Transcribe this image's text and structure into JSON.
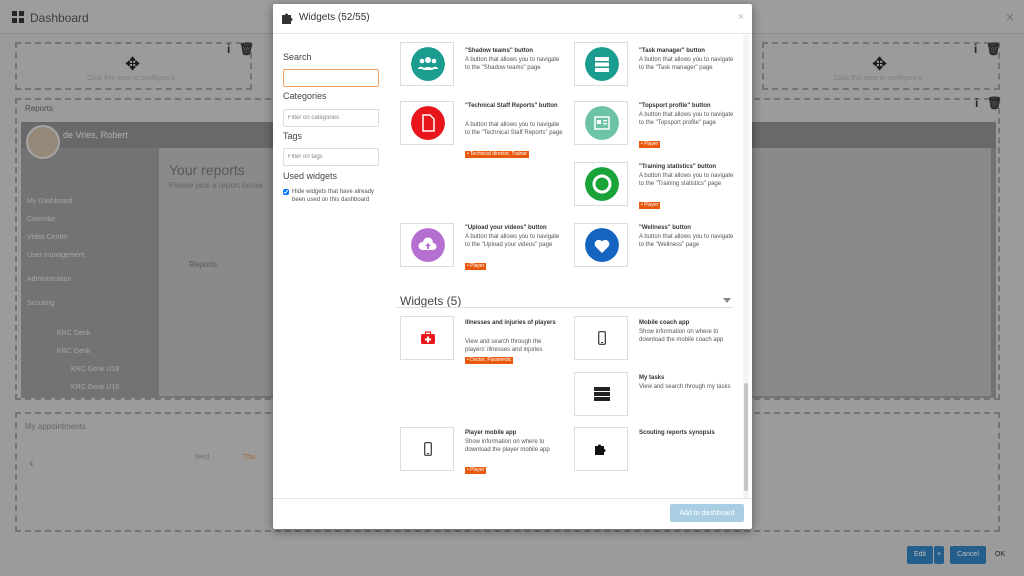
{
  "background": {
    "title": "Dashboard",
    "placeholder_text": "Click this area to configure it",
    "reports_title": "Reports",
    "user_name": "de Vries, Robert",
    "sidebar_items": [
      "My Dashboard",
      "Calendar",
      "Video Center",
      "User management",
      "Administration",
      "Scouting",
      "KRC Genk",
      "KRC Genk",
      "KRC Genk U18",
      "KRC Genk U16"
    ],
    "main_title": "Your reports",
    "main_sub": "Please pick a report below",
    "reports_label": "Reports",
    "appointments_title": "My appointments",
    "day1": "Wed",
    "day2": "Thu",
    "edit_label": "Edit",
    "plus_label": "+",
    "cancel_label": "Cancel",
    "ok_label": "OK"
  },
  "modal": {
    "title": "Widgets (52/55)",
    "close": "×",
    "search_label": "Search",
    "search_value": "",
    "categories_label": "Categories",
    "categories_placeholder": "Filter on categories",
    "tags_label": "Tags",
    "tags_placeholder": "Filter on tags",
    "used_label": "Used widgets",
    "hide_label": "Hide widgets that have already been used on this dashboard",
    "add_button": "Add to dashboard"
  },
  "buttons_widgets": [
    {
      "title": "\"Shadow teams\" button",
      "desc": "A button that allows you to navigate to the \"Shadow teams\" page",
      "tag": "",
      "icon": "people-icon",
      "color": "#1a9c8e"
    },
    {
      "title": "\"Task manager\" button",
      "desc": "A button that allows you to navigate to the \"Task manager\" page",
      "tag": "",
      "icon": "server-icon",
      "color": "#1a9c8e"
    },
    {
      "title": "\"Technical Staff Reports\" button",
      "desc": "A button that allows you to navigate to the \"Technical Staff Reports\" page",
      "tag": "• Technical director, Trainer",
      "icon": "document-icon",
      "color": "#e8161b"
    },
    {
      "title": "\"Topsport profile\" button",
      "desc": "A button that allows you to navigate to the \"Topsport profile\" page",
      "tag": "• Player",
      "icon": "id-card-icon",
      "color": "#6cc4a4"
    },
    {
      "title": "\"Training statistics\" button",
      "desc": "A button that allows you to navigate to the \"Training statistics\" page",
      "tag": "• Player",
      "icon": "lifebuoy-icon",
      "color": "#1aa338"
    },
    {
      "title": "\"Upload your videos\" button",
      "desc": "A button that allows you to navigate to the \"Upload your videos\" page",
      "tag": "• Player",
      "icon": "cloud-upload-icon",
      "color": "#b56fd1"
    },
    {
      "title": "\"Wellness\" button",
      "desc": "A button that allows you to navigate to the \"Wellness\" page",
      "tag": "",
      "icon": "heart-icon",
      "color": "#1565c0"
    }
  ],
  "widgets_section": {
    "title": "Widgets (5)",
    "items": [
      {
        "title": "Illnesses and injuries of players",
        "desc": "View and search through the players' illnesses and injuries",
        "tag": "• Doctor, Paramedic",
        "icon": "medkit-icon"
      },
      {
        "title": "Mobile coach app",
        "desc": "Show information on where to download the mobile coach app",
        "tag": "",
        "icon": "mobile-icon"
      },
      {
        "title": "My tasks",
        "desc": "View and search through my tasks",
        "tag": "",
        "icon": "server-icon"
      },
      {
        "title": "Player mobile app",
        "desc": "Show information on where to download the player mobile app",
        "tag": "• Player",
        "icon": "mobile-icon"
      },
      {
        "title": "Scouting reports synopsis",
        "desc": "",
        "tag": "",
        "icon": "puzzle-icon"
      }
    ]
  }
}
